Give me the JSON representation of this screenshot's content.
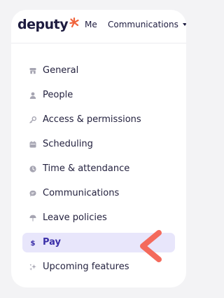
{
  "header": {
    "logo_text": "deputy",
    "nav": [
      {
        "label": "Me"
      },
      {
        "label": "Communications"
      }
    ]
  },
  "menu": {
    "items": [
      {
        "label": "General",
        "icon": "store-icon"
      },
      {
        "label": "People",
        "icon": "person-icon"
      },
      {
        "label": "Access & permissions",
        "icon": "key-icon"
      },
      {
        "label": "Scheduling",
        "icon": "calendar-icon"
      },
      {
        "label": "Time & attendance",
        "icon": "clock-icon"
      },
      {
        "label": "Communications",
        "icon": "chat-icon"
      },
      {
        "label": "Leave policies",
        "icon": "umbrella-icon"
      },
      {
        "label": "Pay",
        "icon": "dollar-icon",
        "active": true
      },
      {
        "label": "Upcoming features",
        "icon": "sparkle-icon"
      }
    ]
  },
  "colors": {
    "accent": "#3b2fa8",
    "active_bg": "#e8e6fb",
    "brand_orange": "#f0643c",
    "pointer": "#f46a5c",
    "text": "#24223f",
    "icon": "#a6a5b2"
  }
}
